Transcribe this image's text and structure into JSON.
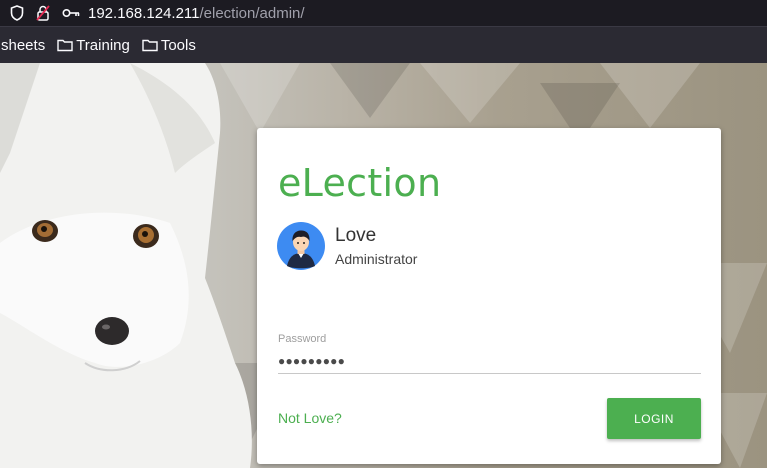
{
  "browser": {
    "url_host": "192.168.124.211",
    "url_path": "/election/admin/",
    "icons": [
      "shield-icon",
      "lock-strikethrough-icon",
      "key-icon"
    ],
    "bookmarks": [
      {
        "label": "sheets",
        "icon": "none"
      },
      {
        "label": "Training",
        "icon": "folder-icon"
      },
      {
        "label": "Tools",
        "icon": "folder-icon"
      }
    ]
  },
  "login": {
    "brand": "eLection",
    "user_name": "Love",
    "user_role": "Administrator",
    "password_label": "Password",
    "password_value": "●●●●●●●●●",
    "not_user_link": "Not Love?",
    "login_button": "LOGIN"
  },
  "colors": {
    "accent": "#4caf50",
    "chrome_bg": "#1c1b22",
    "bookmarks_bg": "#2b2a33",
    "avatar_bg": "#3d8bf2"
  }
}
